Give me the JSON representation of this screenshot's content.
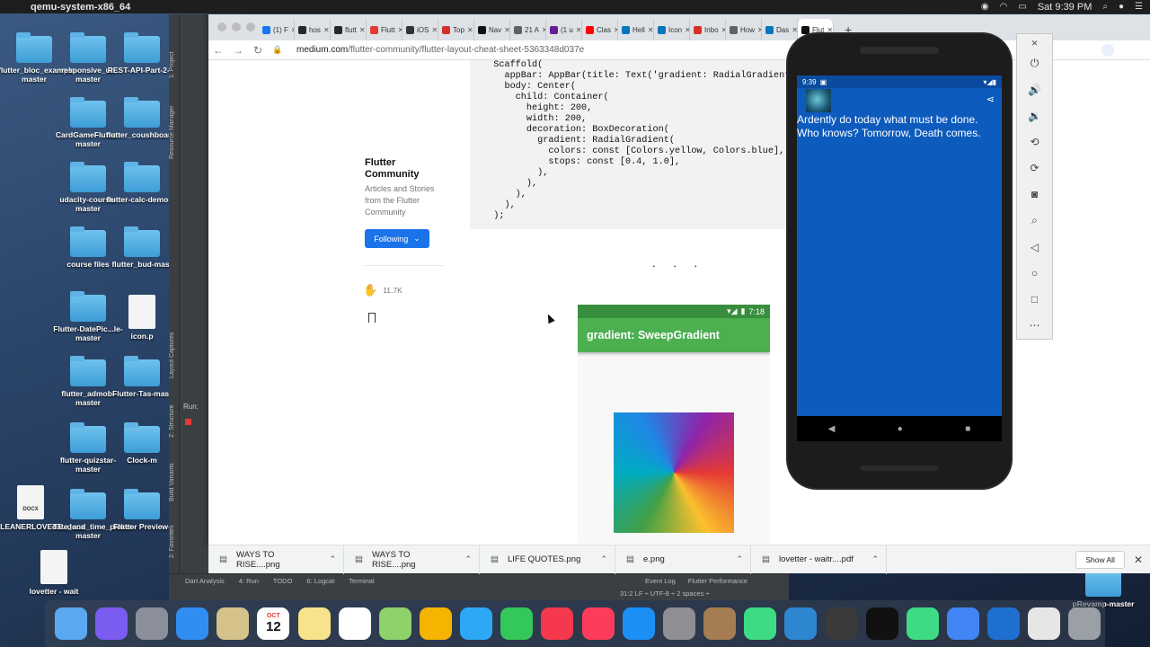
{
  "menubar": {
    "app": "qemu-system-x86_64",
    "clock": "Sat 9:39 PM"
  },
  "desktop": {
    "items": [
      {
        "label": "flutter_bloc_example-master",
        "type": "folder"
      },
      {
        "label": "responsive_ui-master",
        "type": "folder"
      },
      {
        "label": "REST-API-Part-2-m",
        "type": "folder"
      },
      {
        "label": "CardGameFlutter-master",
        "type": "folder"
      },
      {
        "label": "flutter_coushboard_ui",
        "type": "folder"
      },
      {
        "label": "udacity-course-master",
        "type": "folder"
      },
      {
        "label": "flutter-calc-demo-m",
        "type": "folder"
      },
      {
        "label": "course files",
        "type": "folder"
      },
      {
        "label": "flutter_bud-mast",
        "type": "folder"
      },
      {
        "label": "Flutter-DatePic...le-master",
        "type": "folder"
      },
      {
        "label": "icon.p",
        "type": "file"
      },
      {
        "label": "flutter_admob-master",
        "type": "folder"
      },
      {
        "label": "Flutter-Tas-mast",
        "type": "folder"
      },
      {
        "label": "flutter-quizstar-master",
        "type": "folder"
      },
      {
        "label": "Clock-m",
        "type": "folder"
      },
      {
        "label": "CLEANERLOVETT...docx",
        "type": "doc",
        "badge": "DOCX"
      },
      {
        "label": "date_and_time_picker-master",
        "type": "folder"
      },
      {
        "label": "Flutter Preview-",
        "type": "folder"
      },
      {
        "label": "lovetter - wait",
        "type": "doc",
        "badge": ""
      },
      {
        "label": "pRevamp-master",
        "type": "folder"
      }
    ]
  },
  "ide": {
    "side_tabs": [
      "1: Project",
      "Resource Manager",
      "Layout Captures",
      "Z: Structure",
      "Build Variants",
      "2: Favorites"
    ],
    "run_label": "Run:",
    "bottom_tabs": [
      "Dart Analysis",
      "4: Run",
      "TODO",
      "6: Logcat",
      "Terminal",
      "Event Log",
      "Flutter Performance"
    ],
    "status": "31:2  LF ÷  UTF-8 ÷  2 spaces ÷"
  },
  "browser": {
    "tabs": [
      {
        "label": "(1) F",
        "color": "#1877f2"
      },
      {
        "label": "hos",
        "color": "#24292e"
      },
      {
        "label": "flutt",
        "color": "#24292e"
      },
      {
        "label": "Flutt",
        "color": "#e53935"
      },
      {
        "label": "iOS",
        "color": "#333333"
      },
      {
        "label": "Top",
        "color": "#d32f2f"
      },
      {
        "label": "Nav",
        "color": "#111111"
      },
      {
        "label": "21 A",
        "color": "#5f6368"
      },
      {
        "label": "(1 u",
        "color": "#6a1b9a"
      },
      {
        "label": "Clas",
        "color": "#ff0000"
      },
      {
        "label": "Hell",
        "color": "#0277bd"
      },
      {
        "label": "Icon",
        "color": "#0277bd"
      },
      {
        "label": "Inbo",
        "color": "#d93025"
      },
      {
        "label": "How",
        "color": "#5f6368"
      },
      {
        "label": "Das",
        "color": "#0277bd"
      },
      {
        "label": "Flut",
        "color": "#111111",
        "active": true
      }
    ],
    "url_host": "medium.com",
    "url_path": "/flutter-community/flutter-layout-cheat-sheet-5363348d037e",
    "new_tab": "+"
  },
  "article": {
    "code": "  Scaffold(\n    appBar: AppBar(title: Text('gradient: RadialGradient')),\n    body: Center(\n      child: Container(\n        height: 200,\n        width: 200,\n        decoration: BoxDecoration(\n          gradient: RadialGradient(\n            colors: const [Colors.yellow, Colors.blue],\n            stops: const [0.4, 1.0],\n          ),\n        ),\n      ),\n    ),\n  );",
    "publication_name": "Flutter Community",
    "publication_desc": "Articles and Stories from the Flutter Community",
    "follow_label": "Following",
    "claps": "11.7K",
    "section_break": ". . .",
    "phone_time": "7:18",
    "phone_title": "gradient: SweepGradient"
  },
  "downloads": {
    "files": [
      "WAYS TO RISE....png",
      "WAYS TO RISE....png",
      "LIFE QUOTES.png",
      "e.png",
      "lovetter - waitr....pdf"
    ],
    "show_all": "Show All"
  },
  "emulator": {
    "time": "9:39",
    "quote": "Ardently do today what must be done. Who knows? Tomorrow, Death comes.",
    "accent": "#0d5bbd"
  },
  "emulator_toolbar": [
    "power-icon",
    "volume-up-icon",
    "volume-down-icon",
    "rotate-left-icon",
    "rotate-right-icon",
    "camera-icon",
    "zoom-icon",
    "back-icon",
    "home-icon",
    "overview-icon",
    "more-icon"
  ],
  "dock": [
    "finder",
    "siri",
    "launchpad",
    "safari",
    "mail",
    "calendar",
    "notes",
    "reminders",
    "maps",
    "photos",
    "messages",
    "facetime",
    "news",
    "music",
    "app-store",
    "system-preferences",
    "archive",
    "android-emulator",
    "simulator",
    "sublime",
    "terminal",
    "android-studio",
    "chrome",
    "quicktime",
    "preview",
    "trash"
  ],
  "dock_calendar": {
    "month": "OCT",
    "day": "12"
  }
}
